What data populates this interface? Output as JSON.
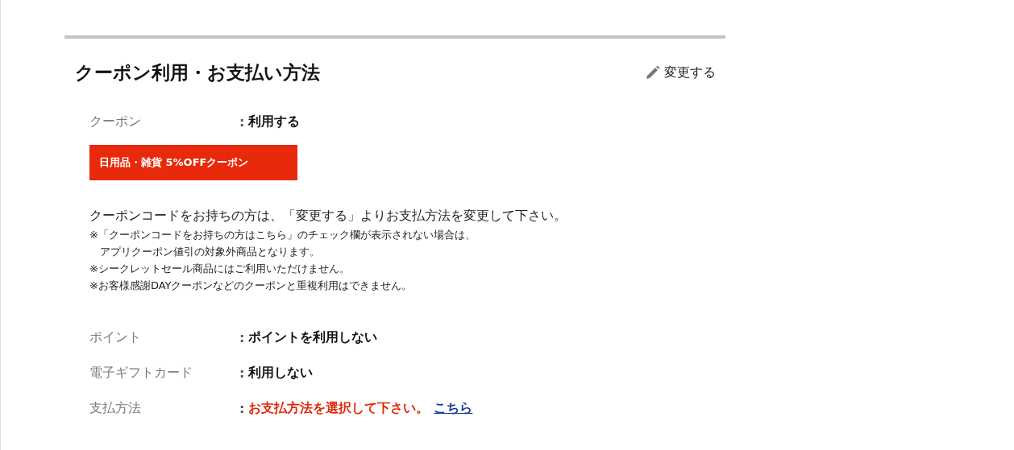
{
  "section": {
    "title": "クーポン利用・お支払い方法",
    "edit_link": "変更する"
  },
  "coupon": {
    "label": "クーポン",
    "separator": ":",
    "value": "利用する",
    "badge": "日用品・雑貨 5%OFFクーポン"
  },
  "notes": {
    "lead": "クーポンコードをお持ちの方は、「変更する」よりお支払方法を変更して下さい。",
    "items": [
      "※「クーポンコードをお持ちの方はこちら」のチェック欄が表示されない場合は、",
      "　アプリクーポン値引の対象外商品となります。",
      "※シークレットセール商品にはご利用いただけません。",
      "※お客様感謝DAYクーポンなどのクーポンと重複利用はできません。"
    ]
  },
  "rows": [
    {
      "kind": "plain",
      "label": "ポイント",
      "separator": ":",
      "value": "ポイントを利用しない"
    },
    {
      "kind": "plain",
      "label": "電子ギフトカード",
      "separator": ":",
      "value": "利用しない"
    },
    {
      "kind": "warning",
      "label": "支払方法",
      "separator": ":",
      "value": "お支払方法を選択して下さい。",
      "link": "こちら"
    }
  ]
}
